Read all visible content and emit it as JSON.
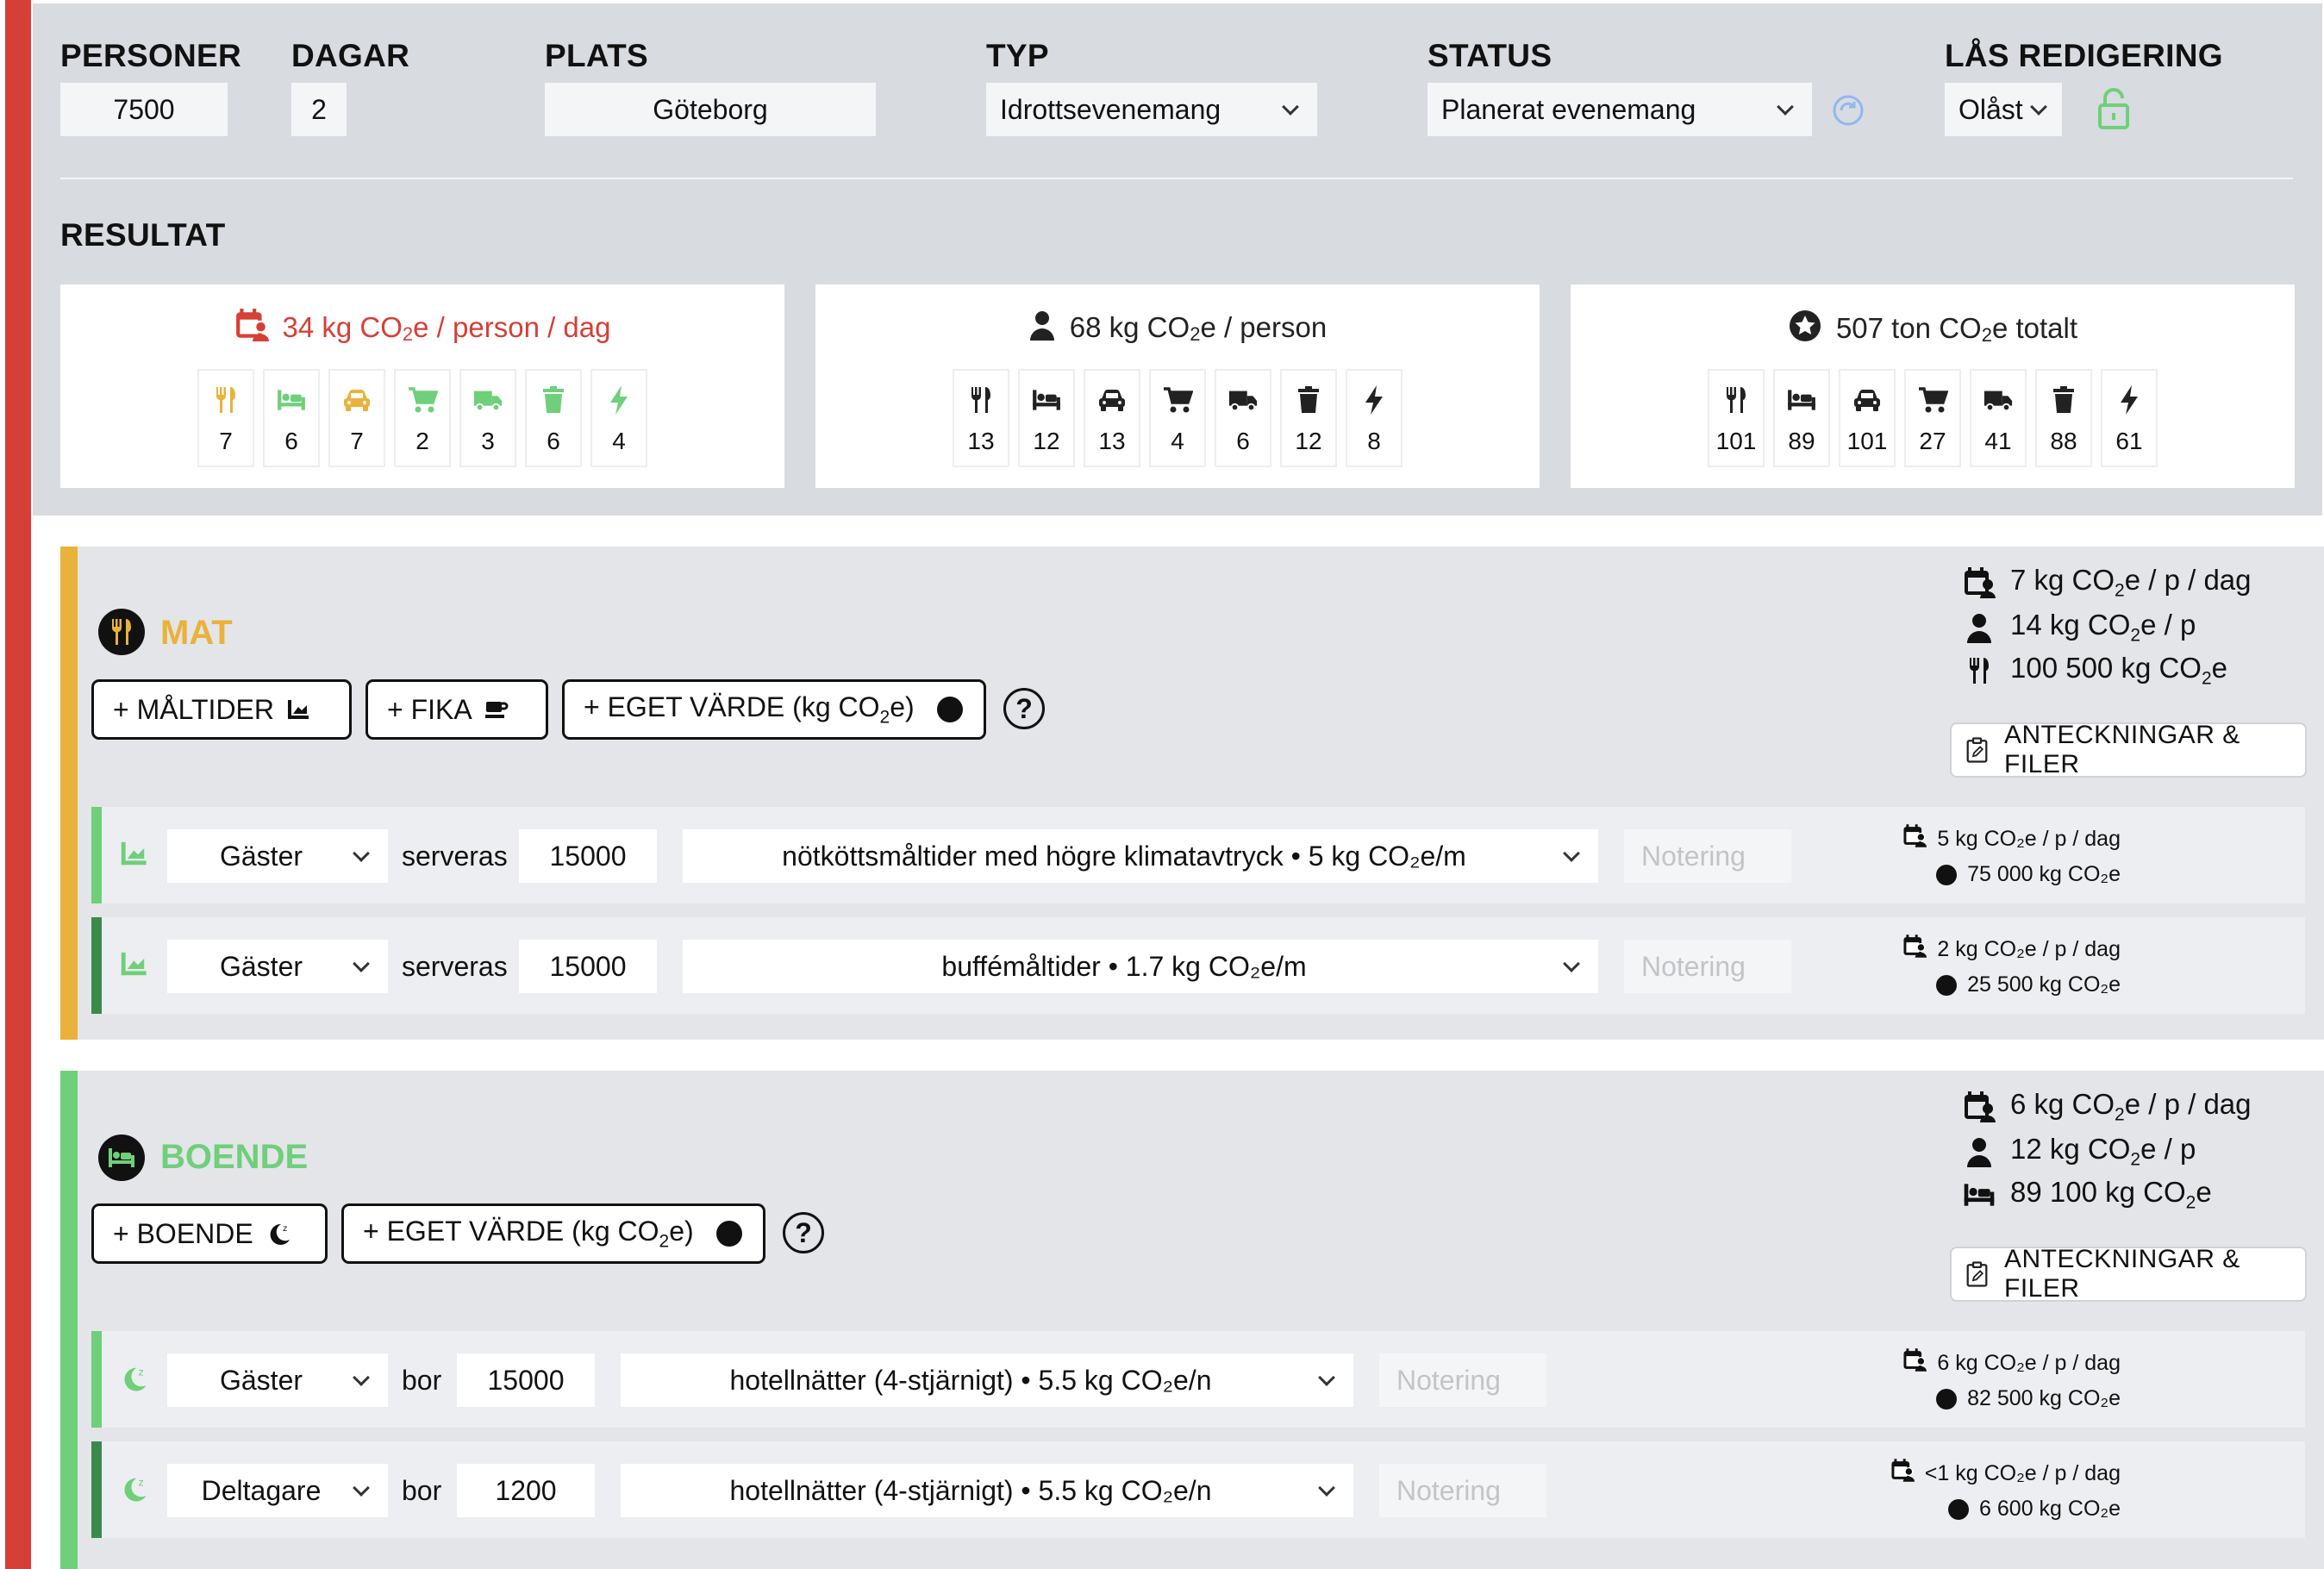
{
  "fields": {
    "personer": {
      "label": "PERSONER",
      "value": "7500"
    },
    "dagar": {
      "label": "DAGAR",
      "value": "2"
    },
    "plats": {
      "label": "PLATS",
      "value": "Göteborg"
    },
    "typ": {
      "label": "TYP",
      "value": "Idrottsevenemang"
    },
    "status": {
      "label": "STATUS",
      "value": "Planerat evenemang"
    },
    "las": {
      "label": "LÅS REDIGERING",
      "value": "Olåst"
    }
  },
  "resultat": {
    "heading": "RESULTAT",
    "cards": [
      {
        "pre": "34 kg CO",
        "sub": "2",
        "post": "e / person / dag",
        "icon": "calendar-person-icon",
        "color": "#d63f35",
        "tiles": [
          {
            "icon": "fork-knife-icon",
            "value": "7",
            "color": "#e9b23b"
          },
          {
            "icon": "bed-icon",
            "value": "6",
            "color": "#6fcf7a"
          },
          {
            "icon": "car-icon",
            "value": "7",
            "color": "#e9b23b"
          },
          {
            "icon": "cart-icon",
            "value": "2",
            "color": "#6fcf7a"
          },
          {
            "icon": "truck-icon",
            "value": "3",
            "color": "#6fcf7a"
          },
          {
            "icon": "trash-icon",
            "value": "6",
            "color": "#6fcf7a"
          },
          {
            "icon": "bolt-icon",
            "value": "4",
            "color": "#6fcf7a"
          }
        ]
      },
      {
        "pre": "68 kg CO",
        "sub": "2",
        "post": "e / person",
        "icon": "person-icon",
        "color": "#222",
        "tiles": [
          {
            "icon": "fork-knife-icon",
            "value": "13",
            "color": "#222"
          },
          {
            "icon": "bed-icon",
            "value": "12",
            "color": "#222"
          },
          {
            "icon": "car-icon",
            "value": "13",
            "color": "#222"
          },
          {
            "icon": "cart-icon",
            "value": "4",
            "color": "#222"
          },
          {
            "icon": "truck-icon",
            "value": "6",
            "color": "#222"
          },
          {
            "icon": "trash-icon",
            "value": "12",
            "color": "#222"
          },
          {
            "icon": "bolt-icon",
            "value": "8",
            "color": "#222"
          }
        ]
      },
      {
        "pre": "507 ton CO",
        "sub": "2",
        "post": "e totalt",
        "icon": "star-circle-icon",
        "color": "#222",
        "tiles": [
          {
            "icon": "fork-knife-icon",
            "value": "101",
            "color": "#222"
          },
          {
            "icon": "bed-icon",
            "value": "89",
            "color": "#222"
          },
          {
            "icon": "car-icon",
            "value": "101",
            "color": "#222"
          },
          {
            "icon": "cart-icon",
            "value": "27",
            "color": "#222"
          },
          {
            "icon": "truck-icon",
            "value": "41",
            "color": "#222"
          },
          {
            "icon": "trash-icon",
            "value": "88",
            "color": "#222"
          },
          {
            "icon": "bolt-icon",
            "value": "61",
            "color": "#222"
          }
        ]
      }
    ]
  },
  "mat": {
    "title": "MAT",
    "color": "#e9b23b",
    "buttons": {
      "maltider": "+ MÅLTIDER",
      "fika": "+ FIKA",
      "eget_pre": "+ EGET VÄRDE (kg CO",
      "eget_sub": "2",
      "eget_post": "e)"
    },
    "help": "?",
    "stats": {
      "per_day_pre": "7 kg CO",
      "per_day_post": "e / p / dag",
      "per_person_pre": "14 kg CO",
      "per_person_post": "e / p",
      "total_pre": "100 500 kg CO",
      "total_post": "e"
    },
    "notes_label": "ANTECKNINGAR & FILER",
    "rows": [
      {
        "who": "Gäster",
        "verb": "serveras",
        "amount": "15000",
        "option": "nötköttsmåltider med högre klimatavtryck • 5 kg CO₂e/m",
        "note_placeholder": "Notering",
        "stat1": "5 kg CO₂e / p / dag",
        "stat2": "75 000 kg CO₂e",
        "barcolor": "#6fcf7a"
      },
      {
        "who": "Gäster",
        "verb": "serveras",
        "amount": "15000",
        "option": "buffémåltider • 1.7 kg CO₂e/m",
        "note_placeholder": "Notering",
        "stat1": "2 kg CO₂e / p / dag",
        "stat2": "25 500 kg CO₂e",
        "barcolor": "#3a8a4c"
      }
    ]
  },
  "boende": {
    "title": "BOENDE",
    "color": "#6fcf7a",
    "buttons": {
      "boende": "+ BOENDE",
      "eget_pre": "+ EGET VÄRDE (kg CO",
      "eget_sub": "2",
      "eget_post": "e)"
    },
    "help": "?",
    "stats": {
      "per_day_pre": "6 kg CO",
      "per_day_post": "e / p / dag",
      "per_person_pre": "12 kg CO",
      "per_person_post": "e / p",
      "total_pre": "89 100 kg CO",
      "total_post": "e"
    },
    "notes_label": "ANTECKNINGAR & FILER",
    "rows": [
      {
        "who": "Gäster",
        "verb": "bor",
        "amount": "15000",
        "option": "hotellnätter (4-stjärnigt) • 5.5 kg CO₂e/n",
        "note_placeholder": "Notering",
        "stat1": "6 kg CO₂e / p / dag",
        "stat2": "82 500 kg CO₂e",
        "barcolor": "#6fcf7a"
      },
      {
        "who": "Deltagare",
        "verb": "bor",
        "amount": "1200",
        "option": "hotellnätter (4-stjärnigt) • 5.5 kg CO₂e/n",
        "note_placeholder": "Notering",
        "stat1": "<1 kg CO₂e / p / dag",
        "stat2": "6 600 kg CO₂e",
        "barcolor": "#3a8a4c"
      }
    ]
  }
}
